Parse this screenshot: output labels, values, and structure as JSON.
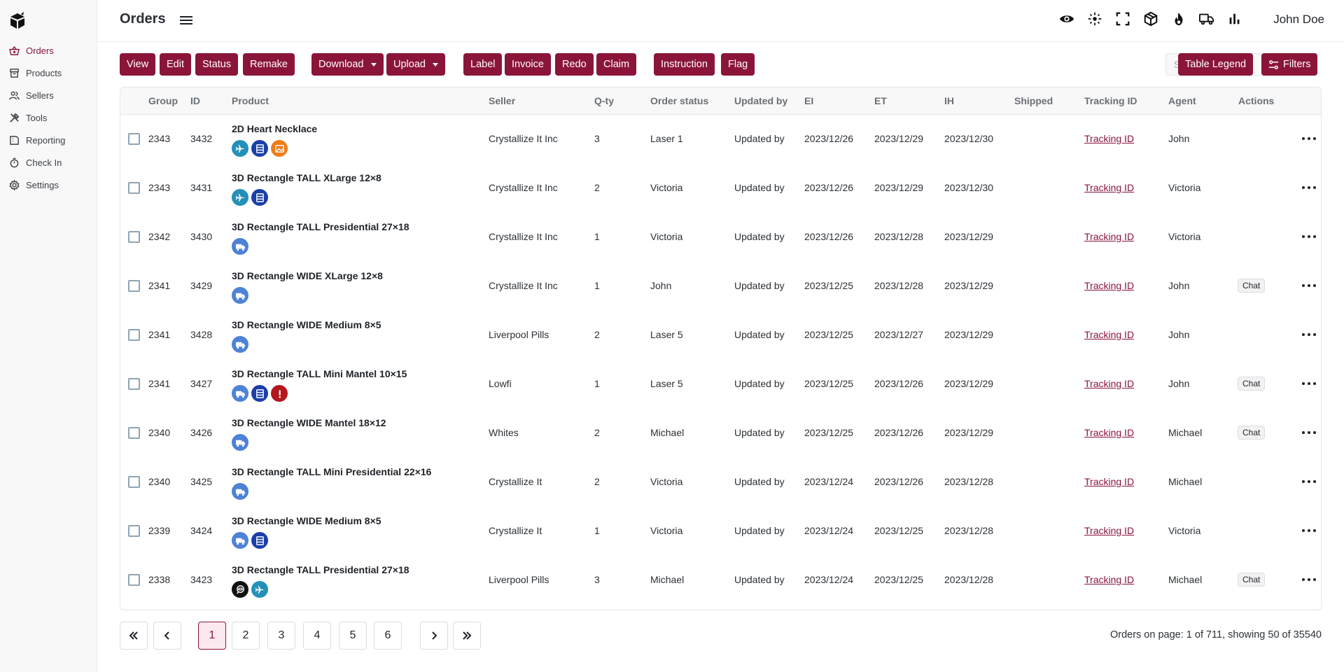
{
  "app": {
    "title": "Orders",
    "user": "John Doe"
  },
  "colors": {
    "accent": "#8a1538",
    "accent_light": "#fbe9ef"
  },
  "sidebar": {
    "items": [
      {
        "label": "Orders",
        "icon": "basket-icon",
        "active": true
      },
      {
        "label": "Products",
        "icon": "archive-icon"
      },
      {
        "label": "Sellers",
        "icon": "users-icon"
      },
      {
        "label": "Tools",
        "icon": "tools-icon"
      },
      {
        "label": "Reporting",
        "icon": "report-icon"
      },
      {
        "label": "Check In",
        "icon": "stopwatch-icon"
      },
      {
        "label": "Settings",
        "icon": "gear-icon"
      }
    ]
  },
  "header": {
    "icons": [
      "eye-icon",
      "sparkle-icon",
      "fullscreen-icon",
      "package-icon",
      "fire-icon",
      "truck-icon",
      "bar-chart-icon"
    ]
  },
  "toolbar": {
    "view": "View",
    "edit": "Edit",
    "status": "Status",
    "remake": "Remake",
    "download": "Download",
    "upload": "Upload",
    "label": "Label",
    "invoice": "Invoice",
    "redo": "Redo",
    "claim": "Claim",
    "instruction": "Instruction",
    "flag": "Flag",
    "search_placeholder": "Search",
    "table_legend": "Table Legend",
    "filters": "Filters"
  },
  "table": {
    "columns": [
      "Group",
      "ID",
      "Product",
      "Seller",
      "Q-ty",
      "Order status",
      "Updated by",
      "EI",
      "ET",
      "IH",
      "Shipped",
      "Tracking ID",
      "Agent",
      "Actions"
    ],
    "rows": [
      {
        "group": "2343",
        "id": "3432",
        "product": "2D Heart Necklace",
        "badges": [
          "plane",
          "server",
          "image"
        ],
        "seller": "Crystallize It Inc",
        "qty": "3",
        "status": "Laser 1",
        "updated_by": "Updated by",
        "ei": "2023/12/26",
        "et": "2023/12/29",
        "ih": "2023/12/30",
        "shipped": "",
        "tracking": "Tracking ID",
        "agent": "John",
        "chat": ""
      },
      {
        "group": "2343",
        "id": "3431",
        "product": "3D Rectangle TALL XLarge 12×8",
        "badges": [
          "plane",
          "server"
        ],
        "seller": "Crystallize It Inc",
        "qty": "2",
        "status": "Victoria",
        "updated_by": "Updated by",
        "ei": "2023/12/26",
        "et": "2023/12/29",
        "ih": "2023/12/30",
        "shipped": "",
        "tracking": "Tracking ID",
        "agent": "Victoria",
        "chat": ""
      },
      {
        "group": "2342",
        "id": "3430",
        "product": "3D Rectangle TALL Presidential 27×18",
        "badges": [
          "truck"
        ],
        "seller": "Crystallize It Inc",
        "qty": "1",
        "status": "Victoria",
        "updated_by": "Updated by",
        "ei": "2023/12/26",
        "et": "2023/12/28",
        "ih": "2023/12/29",
        "shipped": "",
        "tracking": "Tracking ID",
        "agent": "Victoria",
        "chat": ""
      },
      {
        "group": "2341",
        "id": "3429",
        "product": "3D Rectangle WIDE XLarge 12×8",
        "badges": [
          "truck"
        ],
        "seller": "Crystallize It Inc",
        "qty": "1",
        "status": "John",
        "updated_by": "Updated by",
        "ei": "2023/12/25",
        "et": "2023/12/28",
        "ih": "2023/12/29",
        "shipped": "",
        "tracking": "Tracking ID",
        "agent": "John",
        "chat": "Chat"
      },
      {
        "group": "2341",
        "id": "3428",
        "product": "3D Rectangle WIDE Medium 8×5",
        "badges": [
          "truck"
        ],
        "seller": "Liverpool Pills",
        "qty": "2",
        "status": "Laser 5",
        "updated_by": "Updated by",
        "ei": "2023/12/25",
        "et": "2023/12/27",
        "ih": "2023/12/29",
        "shipped": "",
        "tracking": "Tracking ID",
        "agent": "John",
        "chat": ""
      },
      {
        "group": "2341",
        "id": "3427",
        "product": "3D Rectangle TALL Mini Mantel 10×15",
        "badges": [
          "truck",
          "server",
          "alert"
        ],
        "seller": "Lowfi",
        "qty": "1",
        "status": "Laser 5",
        "updated_by": "Updated by",
        "ei": "2023/12/25",
        "et": "2023/12/26",
        "ih": "2023/12/29",
        "shipped": "",
        "tracking": "Tracking ID",
        "agent": "John",
        "chat": "Chat"
      },
      {
        "group": "2340",
        "id": "3426",
        "product": "3D Rectangle WIDE Mantel 18×12",
        "badges": [
          "truck"
        ],
        "seller": "Whites",
        "qty": "2",
        "status": "Michael",
        "updated_by": "Updated by",
        "ei": "2023/12/25",
        "et": "2023/12/26",
        "ih": "2023/12/29",
        "shipped": "",
        "tracking": "Tracking ID",
        "agent": "Michael",
        "chat": "Chat"
      },
      {
        "group": "2340",
        "id": "3425",
        "product": "3D Rectangle TALL Mini Presidential 22×16",
        "badges": [
          "truck"
        ],
        "seller": "Crystallize It",
        "qty": "2",
        "status": "Victoria",
        "updated_by": "Updated by",
        "ei": "2023/12/24",
        "et": "2023/12/26",
        "ih": "2023/12/28",
        "shipped": "",
        "tracking": "Tracking ID",
        "agent": "Michael",
        "chat": ""
      },
      {
        "group": "2339",
        "id": "3424",
        "product": "3D Rectangle WIDE Medium 8×5",
        "badges": [
          "truck",
          "server"
        ],
        "seller": "Crystallize It",
        "qty": "1",
        "status": "Victoria",
        "updated_by": "Updated by",
        "ei": "2023/12/24",
        "et": "2023/12/25",
        "ih": "2023/12/28",
        "shipped": "",
        "tracking": "Tracking ID",
        "agent": "Victoria",
        "chat": ""
      },
      {
        "group": "2338",
        "id": "3423",
        "product": "3D Rectangle TALL Presidential 27×18",
        "badges": [
          "review",
          "plane"
        ],
        "seller": "Liverpool Pills",
        "qty": "3",
        "status": "Michael",
        "updated_by": "Updated by",
        "ei": "2023/12/24",
        "et": "2023/12/25",
        "ih": "2023/12/28",
        "shipped": "",
        "tracking": "Tracking ID",
        "agent": "Michael",
        "chat": "Chat"
      }
    ]
  },
  "pagination": {
    "first": "«",
    "prev": "‹",
    "next": "›",
    "last": "»",
    "pages": [
      "1",
      "2",
      "3",
      "4",
      "5",
      "6"
    ],
    "current": "1",
    "info": "Orders on page: 1 of 711, showing 50 of 35540"
  }
}
